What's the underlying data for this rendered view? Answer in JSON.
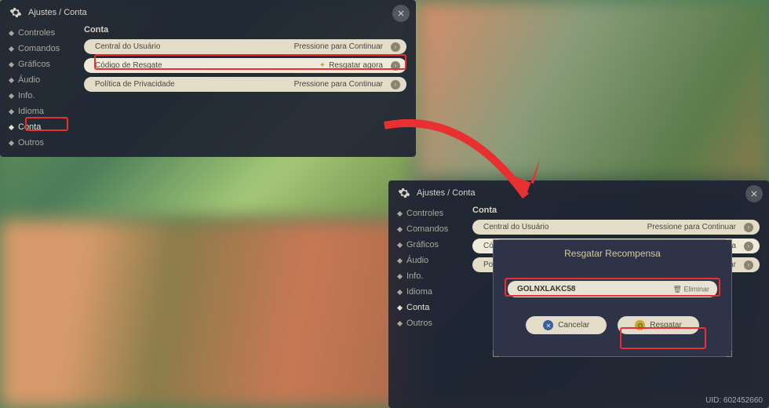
{
  "breadcrumb": "Ajustes / Conta",
  "sidebar": {
    "items": [
      {
        "label": "Controles"
      },
      {
        "label": "Comandos"
      },
      {
        "label": "Gráficos"
      },
      {
        "label": "Áudio"
      },
      {
        "label": "Info."
      },
      {
        "label": "Idioma"
      },
      {
        "label": "Conta"
      },
      {
        "label": "Outros"
      }
    ]
  },
  "section_title": "Conta",
  "rows": [
    {
      "label": "Central do Usuário",
      "action": "Pressione para Continuar"
    },
    {
      "label": "Código de Resgate",
      "action": "Resgatar agora"
    },
    {
      "label": "Política de Privacidade",
      "action": "Pressione para Continuar"
    }
  ],
  "modal": {
    "title": "Resgatar Recompensa",
    "code": "GOLNXLAKC58",
    "clear_label": "Eliminar",
    "cancel_label": "Cancelar",
    "confirm_label": "Resgatar"
  },
  "uid_label": "UID: 602452660"
}
